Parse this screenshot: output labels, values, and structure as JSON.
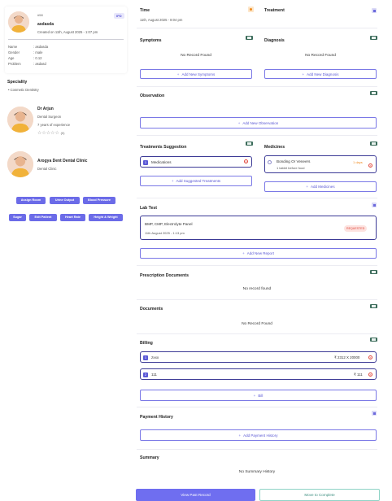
{
  "patient": {
    "id_label": "#58",
    "badge": "IPD",
    "name": "asdasda",
    "created": "Created on 11th, August 2025 - 1:07 pm",
    "fields": [
      {
        "label": "Name",
        "value": ": asdasda"
      },
      {
        "label": "Gender",
        "value": ": male"
      },
      {
        "label": "Age",
        "value": ": 0.12"
      },
      {
        "label": "Problem",
        "value": ": asdasd"
      }
    ]
  },
  "speciality": {
    "title": "Speciality",
    "items": [
      "Cosmetic Dentistry"
    ]
  },
  "doctor": {
    "name": "Dr Arjun",
    "role": "Dental Surgeon",
    "experience": "7 years of experience",
    "stars": "☆☆☆☆☆",
    "rating": "(0)"
  },
  "clinic": {
    "name": "Arogya Dent Dental Clinic",
    "type": "Dental Clinic"
  },
  "actions": {
    "row1": [
      "Assign Room",
      "Urine Output",
      "Blood Pressure"
    ],
    "row2": [
      "Sugar",
      "Edit Patient",
      "Heart Rate",
      "Height & Weight"
    ]
  },
  "time": {
    "title": "Time",
    "value": "11th, August 2025 - 8:04 pm"
  },
  "treatment": {
    "title": "Treatment"
  },
  "symptoms": {
    "title": "Symptoms",
    "empty": "No Record Found",
    "add": "Add New Symptoms"
  },
  "diagnosis": {
    "title": "Diagnosis",
    "empty": "No Record Found",
    "add": "Add New Diagnosis"
  },
  "observation": {
    "title": "Observation",
    "add": "Add New Observation"
  },
  "treatments_suggestion": {
    "title": "Treatments Suggestion",
    "item": "Medications",
    "item_num": "1",
    "add": "Add Suggested Treatments"
  },
  "medicines": {
    "title": "Medicines",
    "name": "Bonding Or Veneers",
    "note": "1 tablet before food",
    "days": "1 days",
    "add": "Add Medicines"
  },
  "lab_test": {
    "title": "Lab Test",
    "name": "BMP, CMP, Electrolyte Panel",
    "date": "11th August 2025 - 1:13 pm",
    "status": "REQUESTED",
    "add": "Add New Report"
  },
  "prescription_docs": {
    "title": "Prescription Documents",
    "empty": "No record found"
  },
  "documents": {
    "title": "Documents",
    "empty": "No Record Found"
  },
  "billing": {
    "title": "Billing",
    "items": [
      {
        "num": "1",
        "name": "zxxx",
        "amount": "₹ 2312 X 20000"
      },
      {
        "num": "2",
        "name": "111",
        "amount": "₹ 111"
      }
    ],
    "add": "Bill"
  },
  "payment_history": {
    "title": "Payment History",
    "add": "Add Payment History"
  },
  "summary": {
    "title": "Summary",
    "empty": "No Summary History"
  },
  "footer": {
    "primary": "View Past Record",
    "secondary": "Move to Complete"
  },
  "colors": {
    "accent": "#6b6be8",
    "danger": "#e0473b",
    "teal": "#3e8f80"
  }
}
